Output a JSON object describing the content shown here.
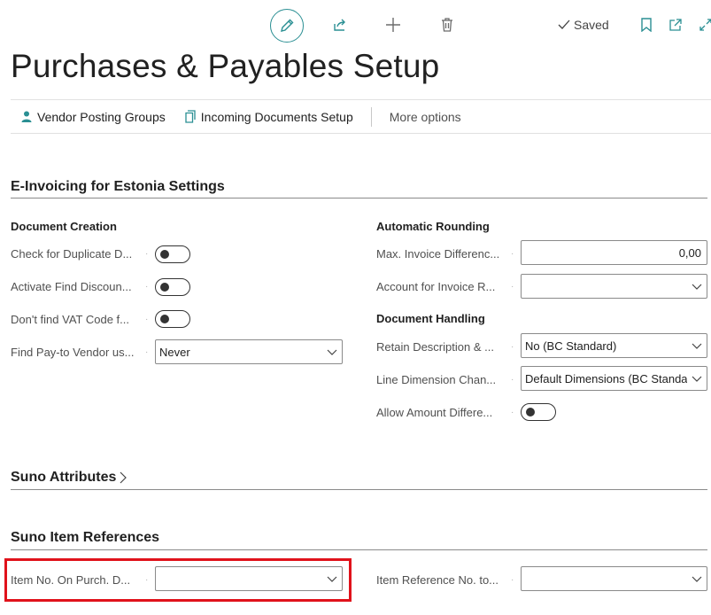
{
  "toolbar": {
    "edit_icon": "pencil-icon",
    "share_icon": "share-icon",
    "new_icon": "plus-icon",
    "delete_icon": "trash-icon",
    "saved_label": "Saved",
    "bookmark_icon": "bookmark-icon",
    "popout_icon": "open-new-window-icon",
    "expand_icon": "expand-icon"
  },
  "page": {
    "title": "Purchases & Payables Setup"
  },
  "actions": {
    "vendor_posting_groups": "Vendor Posting Groups",
    "incoming_documents_setup": "Incoming Documents Setup",
    "more_options": "More options"
  },
  "sections": {
    "einvoicing": {
      "title": "E-Invoicing for Estonia Settings",
      "document_creation": {
        "title": "Document Creation",
        "check_duplicate": "Check for Duplicate D...",
        "activate_find_discount": "Activate Find Discoun...",
        "dont_find_vat": "Don't find VAT Code f...",
        "find_payto_vendor": "Find Pay-to Vendor us...",
        "find_payto_vendor_value": "Never"
      },
      "automatic_rounding": {
        "title": "Automatic Rounding",
        "max_invoice_diff": "Max. Invoice Differenc...",
        "max_invoice_diff_value": "0,00",
        "account_invoice_rounding": "Account for Invoice R...",
        "account_invoice_rounding_value": ""
      },
      "document_handling": {
        "title": "Document Handling",
        "retain_description": "Retain Description & ...",
        "retain_description_value": "No (BC Standard)",
        "line_dimension": "Line Dimension Chan...",
        "line_dimension_value": "Default Dimensions (BC Standa",
        "allow_amount_diff": "Allow Amount Differe..."
      }
    },
    "suno_attributes": {
      "title": "Suno Attributes",
      "chevron": ">"
    },
    "suno_item_refs": {
      "title": "Suno Item References",
      "item_no_on_purch": "Item No. On Purch. D...",
      "item_no_on_purch_value": "",
      "item_reference_no": "Item Reference No. to...",
      "item_reference_no_value": ""
    }
  },
  "colors": {
    "accent": "#2a8f93",
    "highlight": "#e0121b"
  }
}
